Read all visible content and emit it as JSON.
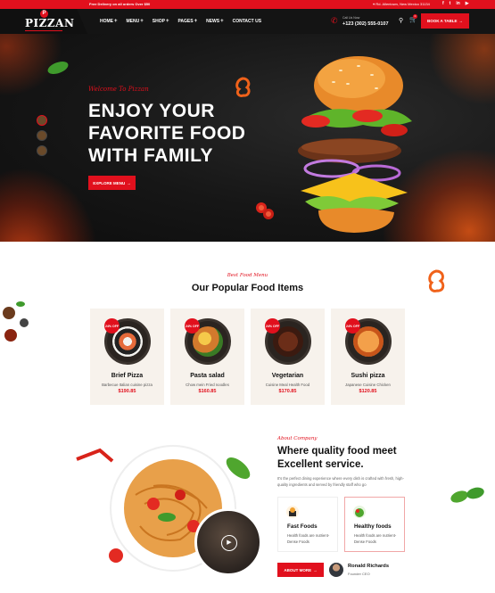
{
  "topbar": {
    "notice": "Free Delivery on all orders Over $50",
    "address": "Rd. Allentown, New Mexico 31134",
    "social_icons": [
      "facebook-icon",
      "twitter-icon",
      "linkedin-icon",
      "youtube-icon"
    ]
  },
  "header": {
    "logo": "PIZZAN",
    "nav": [
      "HOME",
      "MENU",
      "SHOP",
      "PAGES",
      "NEWS",
      "CONTACT US"
    ],
    "call_label": "Call Us Now",
    "phone": "+123 (302) 555-0107",
    "cart_count": "0",
    "book_button": "BOOK A TABLE"
  },
  "hero": {
    "tagline": "Welcome To Pizzan",
    "title_lines": [
      "ENJOY YOUR",
      "FAVORITE FOOD",
      "WITH FAMILY"
    ],
    "button": "EXPLORE MENU"
  },
  "popular": {
    "sublabel": "Best Food Menu",
    "title": "Our Popular Food Items",
    "items": [
      {
        "badge": "24% OFF",
        "name": "Brief Pizza",
        "desc": "Barbecue Italian cuisine pizza",
        "price": "$190.85"
      },
      {
        "badge": "24% OFF",
        "name": "Pasta salad",
        "desc": "Chow mein Fried noodles",
        "price": "$160.85"
      },
      {
        "badge": "24% OFF",
        "name": "Vegetarian",
        "desc": "Cuisine Meal Health Food",
        "price": "$170.85"
      },
      {
        "badge": "24% OFF",
        "name": "Sushi pizza",
        "desc": "Japanese Cuisine Chicken",
        "price": "$120.85"
      }
    ]
  },
  "about": {
    "sublabel": "About Company",
    "title": "Where quality food meet Excellent service.",
    "text": "It's the perfect dining experience where every dish is crafted with fresh, high-quality ingredients and served by friendly staff who go",
    "features": [
      {
        "title": "Fast Foods",
        "desc": "Health foods are nutrient-Dense Foods"
      },
      {
        "title": "Healthy foods",
        "desc": "Health foods are nutrient-Dense Foods"
      }
    ],
    "button": "ABOUT MORE",
    "person_name": "Ronald Richards",
    "person_role": "Founder CEO"
  },
  "colors": {
    "accent": "#e1101d",
    "dark": "#141414",
    "card_bg": "#f7f2ec"
  }
}
